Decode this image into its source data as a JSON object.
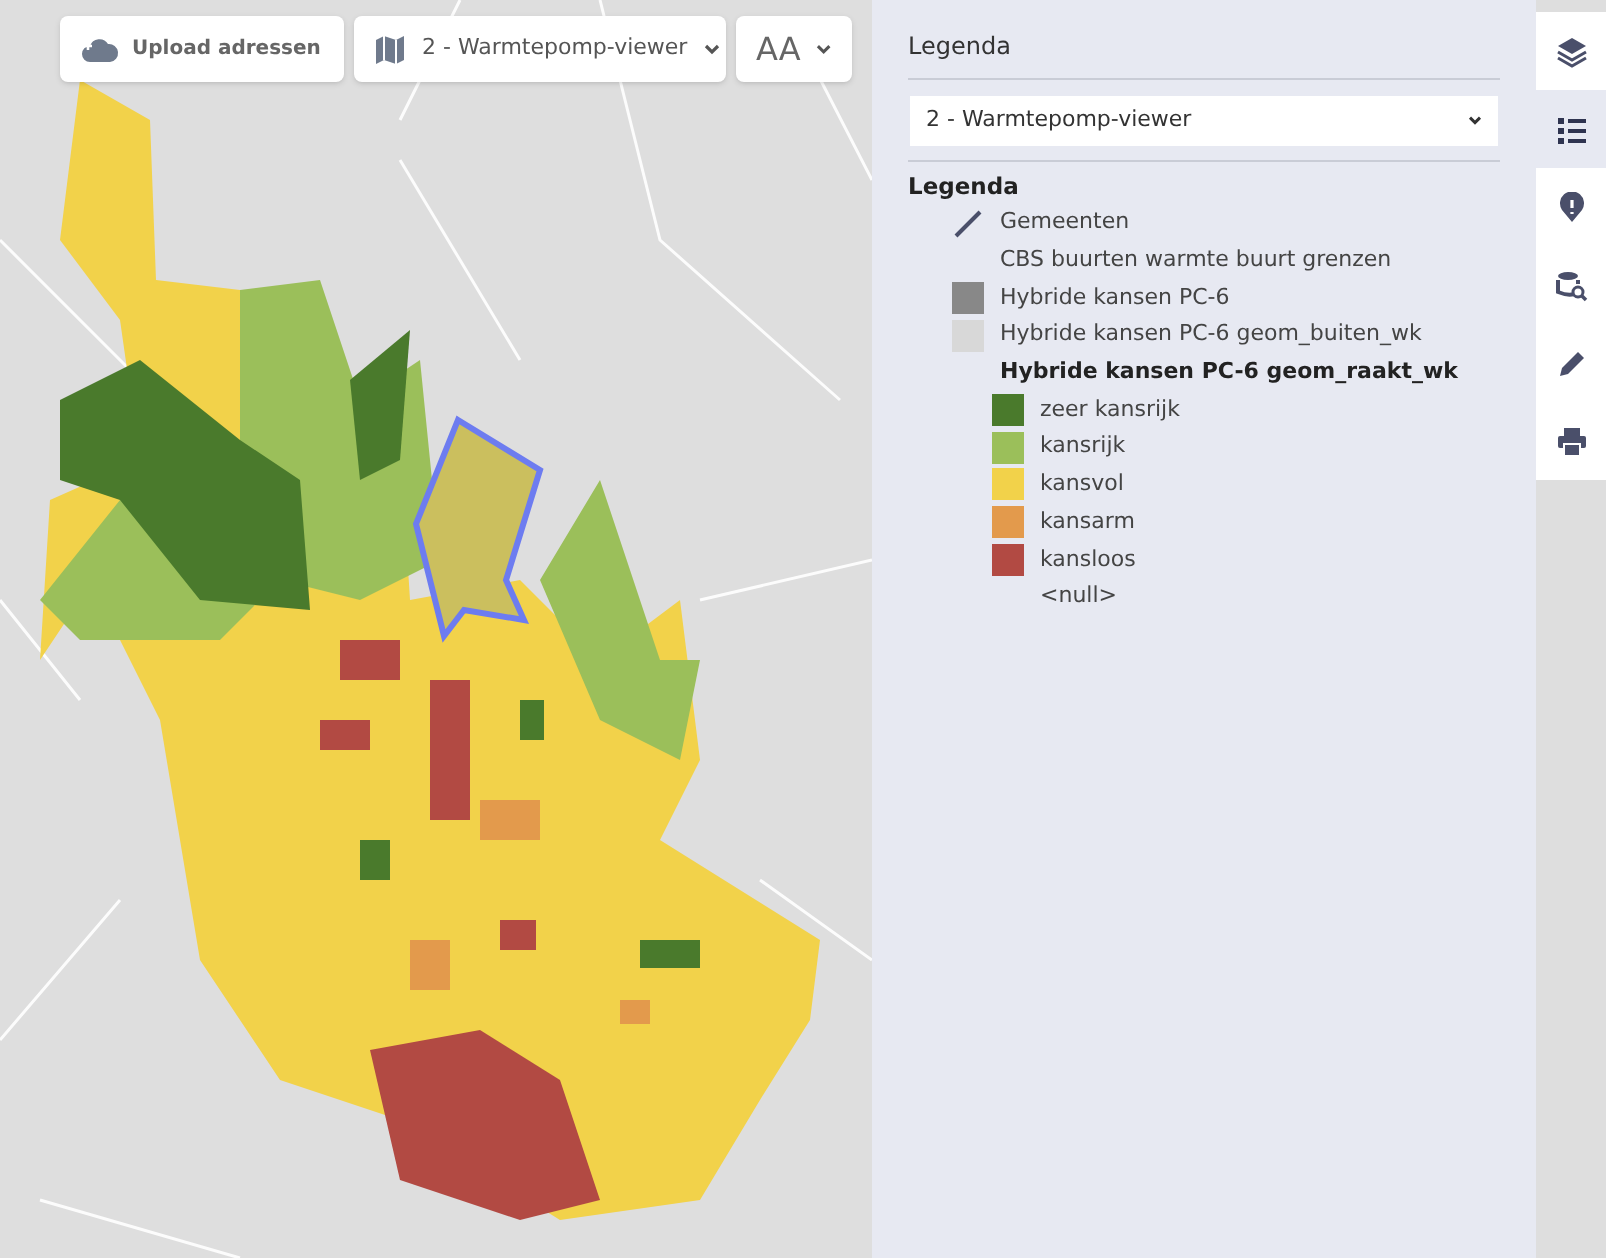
{
  "toolbar": {
    "upload_button": "Upload adressen",
    "map_select": "2 - Warmtepomp-viewer",
    "font_button": "AA"
  },
  "legend_panel": {
    "title": "Legenda",
    "select": "2 - Warmtepomp-viewer",
    "heading": "Legenda",
    "items": [
      {
        "kind": "line",
        "label": "Gemeenten"
      },
      {
        "kind": "none",
        "label": "CBS buurten warmte buurt grenzen"
      },
      {
        "kind": "swatch",
        "label": "Hybride kansen PC-6",
        "color": "#888888"
      },
      {
        "kind": "swatch",
        "label": "Hybride kansen PC-6 geom_buiten_wk",
        "color": "#d8d8d8"
      },
      {
        "kind": "group",
        "label": "Hybride kansen PC-6 geom_raakt_wk",
        "children": [
          {
            "kind": "swatch",
            "label": "zeer kansrijk",
            "color": "#4a7a2c"
          },
          {
            "kind": "swatch",
            "label": "kansrijk",
            "color": "#9bbf5a"
          },
          {
            "kind": "swatch",
            "label": "kansvol",
            "color": "#f2d24a"
          },
          {
            "kind": "swatch",
            "label": "kansarm",
            "color": "#e39a4c"
          },
          {
            "kind": "swatch",
            "label": "kansloos",
            "color": "#b24a43"
          },
          {
            "kind": "none",
            "label": "<null>"
          }
        ]
      }
    ]
  },
  "side_tabs": [
    {
      "kind": "layers",
      "selected": false
    },
    {
      "kind": "list",
      "selected": true
    },
    {
      "kind": "info",
      "selected": false
    },
    {
      "kind": "query",
      "selected": false
    },
    {
      "kind": "edit",
      "selected": false
    },
    {
      "kind": "print",
      "selected": false
    }
  ]
}
